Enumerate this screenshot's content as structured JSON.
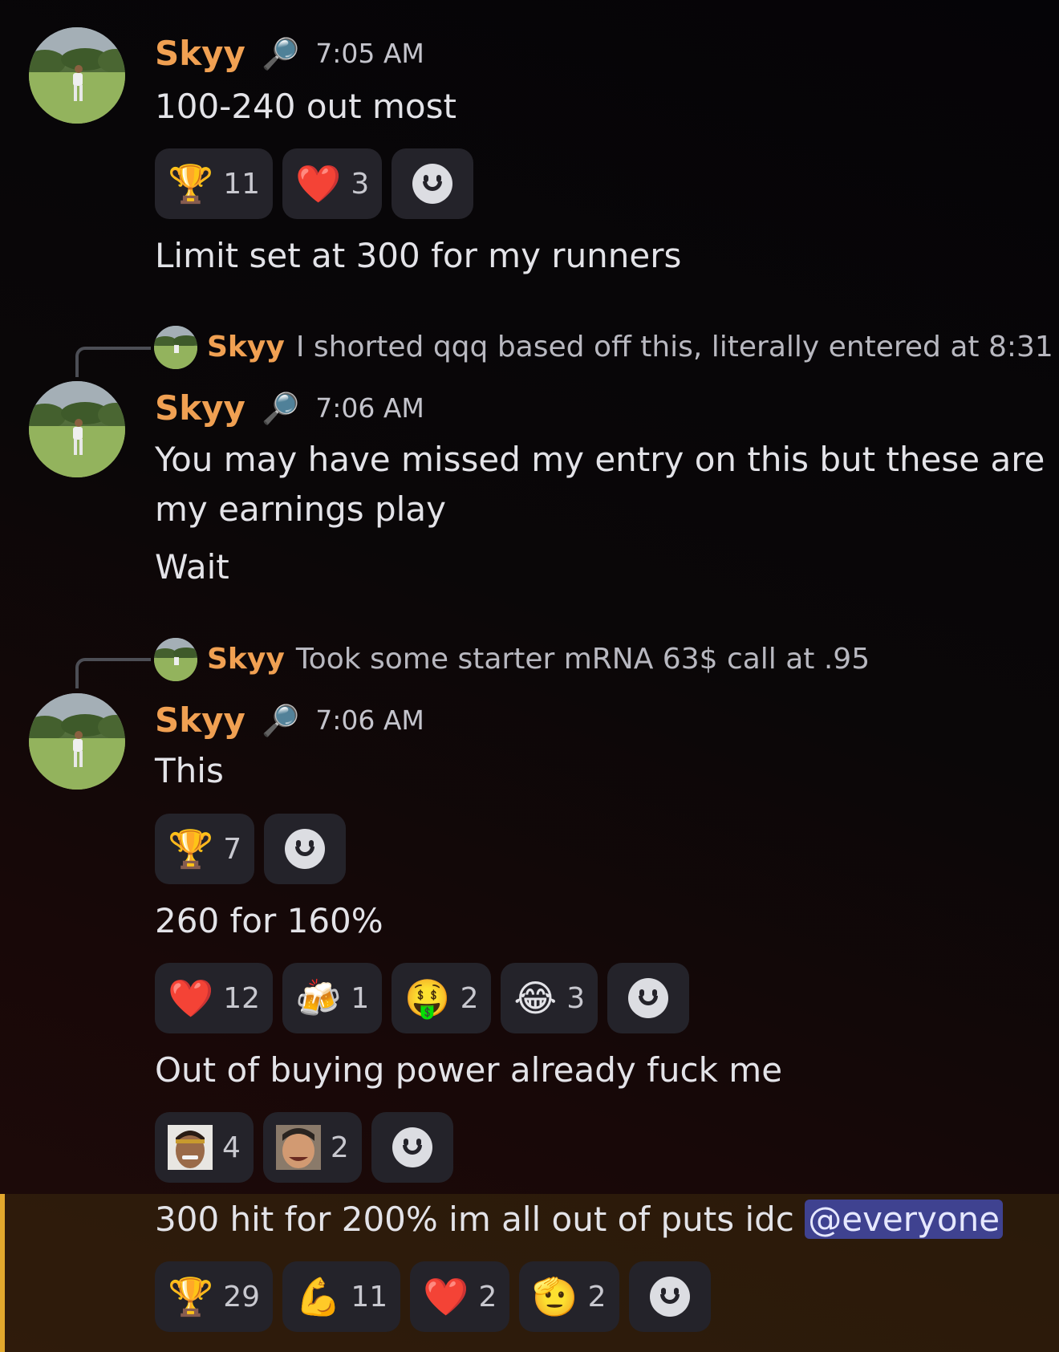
{
  "messages": [
    {
      "username": "Skyy",
      "badge_icon": "magnifier-icon",
      "time": "7:05 AM",
      "lines": [
        "100-240 out most"
      ]
    },
    {
      "line": "Limit set at 300 for my runners"
    },
    {
      "reply": {
        "username": "Skyy",
        "text": "I shorted qqq based off this, literally entered at 8:31"
      },
      "username": "Skyy",
      "badge_icon": "magnifier-icon",
      "time": "7:06 AM",
      "lines": [
        "You may have missed my entry on this but these are",
        "my earnings play",
        "Wait"
      ]
    },
    {
      "reply": {
        "username": "Skyy",
        "text": "Took some starter mRNA 63$ call at .95"
      },
      "username": "Skyy",
      "badge_icon": "magnifier-icon",
      "time": "7:06 AM",
      "lines": [
        "This",
        "260 for 160%",
        "Out of buying power already fuck me",
        "300 hit for 200% im all out of puts idc"
      ],
      "mention": "@everyone"
    }
  ],
  "reactions": {
    "r1": [
      {
        "emoji": "🏆",
        "count": "11"
      },
      {
        "emoji": "❤️",
        "count": "3"
      }
    ],
    "r2": [
      {
        "emoji": "🏆",
        "count": "7"
      }
    ],
    "r3": [
      {
        "emoji": "❤️",
        "count": "12"
      },
      {
        "emoji": "🍻",
        "count": "1"
      },
      {
        "emoji": "🤑",
        "count": "2"
      },
      {
        "emoji": "😂",
        "count": "3"
      }
    ],
    "r4": [
      {
        "emoji": "custom-face-headband",
        "count": "4"
      },
      {
        "emoji": "custom-face-laughing",
        "count": "2"
      }
    ],
    "r5": [
      {
        "emoji": "🏆",
        "count": "29"
      },
      {
        "emoji": "💪",
        "count": "11"
      },
      {
        "emoji": "❤️",
        "count": "2"
      },
      {
        "emoji": "🫡",
        "count": "2"
      }
    ]
  },
  "colors": {
    "username": "#f0a052",
    "mention_bg": "#3f4290",
    "highlight_bar": "#e2a82d",
    "reaction_bg": "#24232a"
  }
}
